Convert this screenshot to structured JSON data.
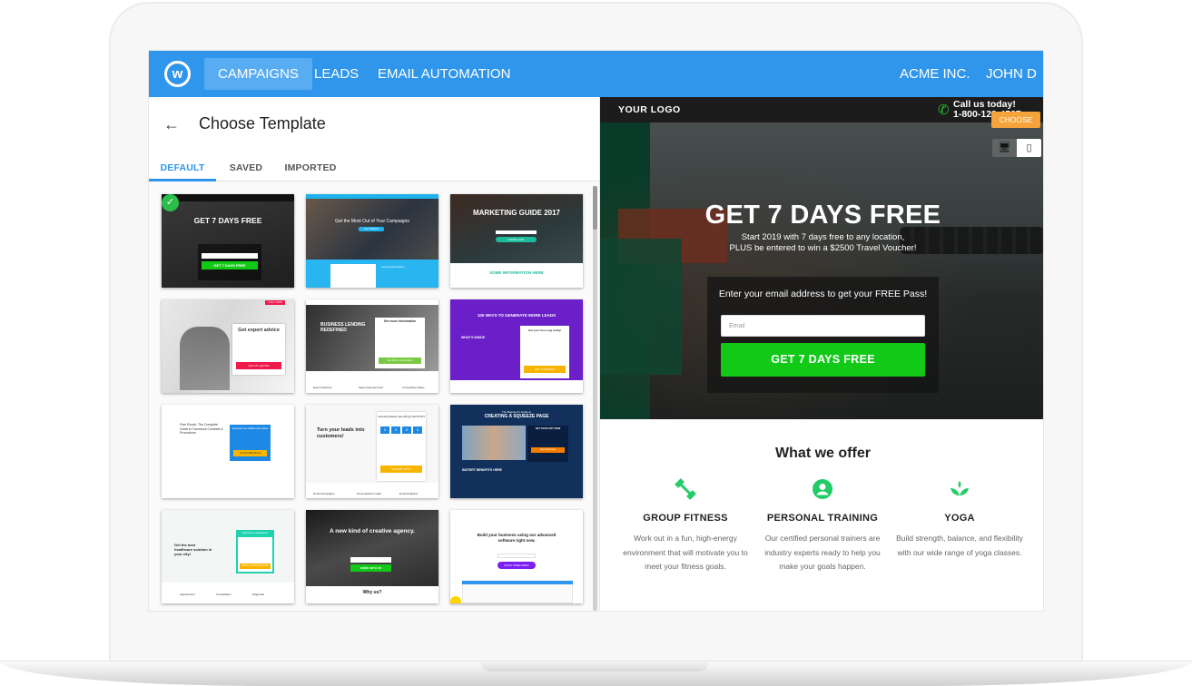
{
  "nav": {
    "logo_letter": "w",
    "items": [
      {
        "label": "CAMPAIGNS",
        "active": true
      },
      {
        "label": "LEADS",
        "active": false
      },
      {
        "label": "EMAIL AUTOMATION",
        "active": false
      }
    ],
    "company": "ACME INC.",
    "user": "JOHN D"
  },
  "left_panel": {
    "back_icon": "←",
    "title": "Choose Template",
    "tabs": [
      {
        "label": "DEFAULT",
        "active": true
      },
      {
        "label": "SAVED",
        "active": false
      },
      {
        "label": "IMPORTED",
        "active": false
      }
    ],
    "templates": [
      {
        "name": "Get 7 Days Free",
        "headline": "GET 7 DAYS FREE",
        "button": "GET 7 DAYS FREE",
        "selected": true
      },
      {
        "name": "Get the Most Out of Your Campaigns",
        "headline": "Get the Most Out of Your Campaigns",
        "button": "Get Started",
        "footer": "Course Description"
      },
      {
        "name": "Marketing Guide 2017",
        "headline": "MARKETING GUIDE 2017",
        "button": "DOWNLOAD",
        "footer": "SOME INFORMATION HERE"
      },
      {
        "name": "Get expert advice",
        "headline": "Get expert advice",
        "button": "GET MY QUOTE",
        "top_button": "CALL NOW"
      },
      {
        "name": "Business Lending Redefined",
        "headline": "BUSINESS LENDING REDEFINED",
        "form_title": "Get more information",
        "button": "Get More Information",
        "features": [
          "Expert Advisors",
          "Same Day Approval",
          "Competitive Rates"
        ]
      },
      {
        "name": "100 Ways to Generate More Leads",
        "headline": "100 WAYS TO GENERATE MORE LEADS",
        "subhead": "WHAT'S INSIDE",
        "form_title": "Get your free copy today!",
        "button": "GET THE BOOK"
      },
      {
        "name": "Free Ebook",
        "headline": "Free Ebook: The Complete Guide to Facebook Contests & Promotions",
        "form_title": "Download Your FREE Guide Today!",
        "button": "Get My FREE Ebook"
      },
      {
        "name": "Turn your leads into customers!",
        "headline": "Turn your leads into customers!",
        "form_title": "Upcoming Webinar June 20th @ 3:00 PM PST",
        "countdown": [
          "0",
          "0",
          "0",
          "0"
        ],
        "button": "SAVE MY SPOT",
        "features": [
          "Email Campaigns",
          "Personalized emails",
          "Email Analytics"
        ]
      },
      {
        "name": "Creating a Squeeze Page",
        "subhead": "The Beginner's Guide to",
        "headline": "CREATING A SQUEEZE PAGE",
        "form_title": "GET YOUR COPY NOW",
        "button": "Download Now",
        "footer": "INSTERT BENEFITS HERE"
      },
      {
        "name": "Get the best healthcare solution in your city!",
        "headline": "Get the best healthcare solution in your city!",
        "form_title": "Schedule an Appointment",
        "button": "BOOK A CONSULTATION",
        "features": [
          "Appointment",
          "Consultation",
          "Diagnosis"
        ]
      },
      {
        "name": "A new kind of creative agency.",
        "headline": "A new kind of creative agency.",
        "button": "WORK WITH US",
        "footer": "Why us?"
      },
      {
        "name": "Build your business",
        "headline": "Build your business using our advanced software right now.",
        "button": "BOOK FREE DEMO"
      }
    ]
  },
  "preview": {
    "logo_text": "YOUR LOGO",
    "call_label": "Call us today!",
    "phone": "1-800-123-4567",
    "choose_label": "CHOOSE",
    "device_icons": {
      "desktop": "desktop-icon",
      "mobile": "mobile-icon"
    },
    "hero_title": "GET 7 DAYS FREE",
    "hero_sub_1": "Start 2019 with 7 days free to any location,",
    "hero_sub_2": "PLUS be entered to win a $2500 Travel Voucher!",
    "form_label": "Enter your email address to get your FREE Pass!",
    "email_placeholder": "Email",
    "cta_label": "GET 7 DAYS FREE",
    "offer_title": "What we offer",
    "features": [
      {
        "icon": "dumbbell-icon",
        "title": "GROUP FITNESS",
        "desc": "Work out in a fun, high-energy environment that will motivate you to meet your fitness goals."
      },
      {
        "icon": "person-icon",
        "title": "PERSONAL TRAINING",
        "desc": "Our certified personal trainers are industry experts ready to help you make your goals happen."
      },
      {
        "icon": "lotus-icon",
        "title": "YOGA",
        "desc": "Build strength, balance, and flexibility with our wide range of  yoga classes."
      }
    ],
    "accent_green": "#11c916",
    "choose_color": "#f6a33b"
  },
  "colors": {
    "nav_blue": "#2f96ec",
    "nav_active": "#58acf1",
    "tab_active": "#2f96ec"
  }
}
